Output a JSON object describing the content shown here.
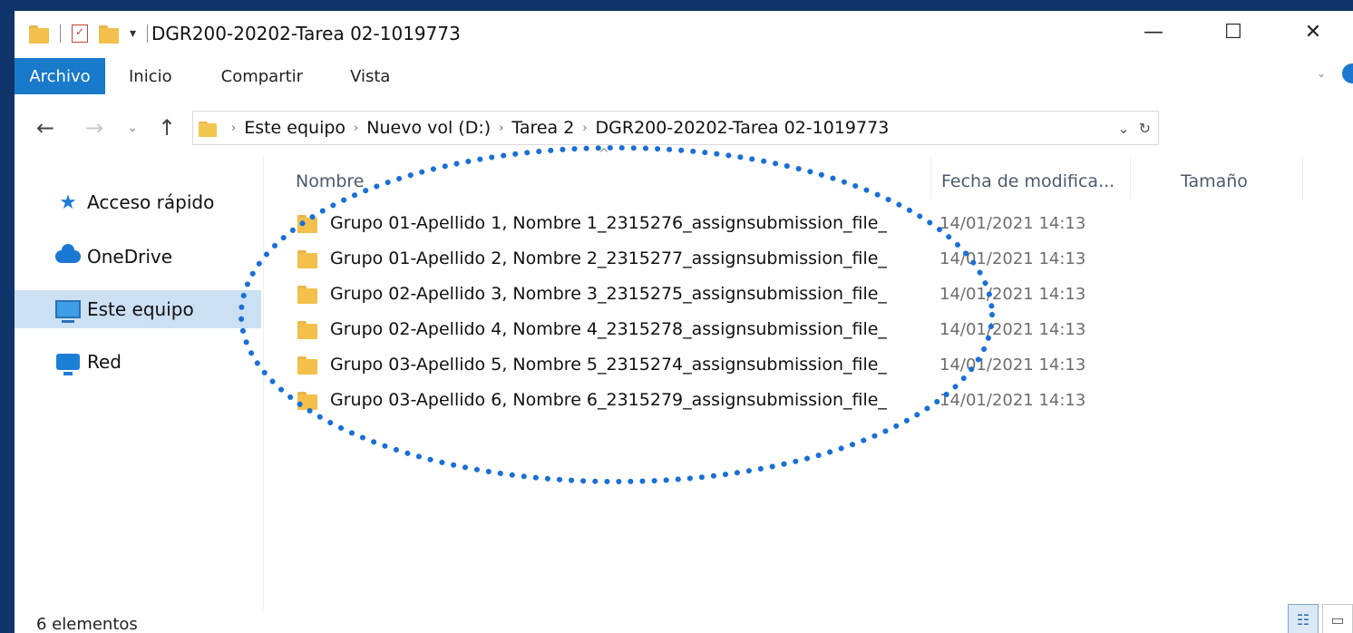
{
  "window": {
    "title": "DGR200-20202-Tarea 02-1019773",
    "quick_access_dropdown": "▾",
    "controls": {
      "minimize": "—",
      "maximize": "☐",
      "close": "✕"
    }
  },
  "ribbon": {
    "tabs": [
      "Archivo",
      "Inicio",
      "Compartir",
      "Vista"
    ],
    "expand_chevron": "⌄"
  },
  "nav": {
    "back": "←",
    "forward": "→",
    "recent": "⌄",
    "up": "↑",
    "breadcrumb": [
      "Este equipo",
      "Nuevo vol (D:)",
      "Tarea 2",
      "DGR200-20202-Tarea 02-1019773"
    ],
    "breadcrumb_separator": "›",
    "history_dropdown": "⌄",
    "refresh": "↻"
  },
  "sidebar": {
    "items": [
      {
        "label": "Acceso rápido",
        "icon": "star-icon"
      },
      {
        "label": "OneDrive",
        "icon": "cloud-icon"
      },
      {
        "label": "Este equipo",
        "icon": "computer-icon",
        "selected": true
      },
      {
        "label": "Red",
        "icon": "network-icon"
      }
    ]
  },
  "columns": {
    "name": "Nombre",
    "date": "Fecha de modifica...",
    "size": "Tamaño",
    "sort_indicator": "^"
  },
  "files": [
    {
      "name": "Grupo 01-Apellido 1, Nombre 1_2315276_assignsubmission_file_",
      "date": "14/01/2021 14:13",
      "type": "folder"
    },
    {
      "name": "Grupo 01-Apellido 2, Nombre 2_2315277_assignsubmission_file_",
      "date": "14/01/2021 14:13",
      "type": "folder"
    },
    {
      "name": "Grupo 02-Apellido 3, Nombre 3_2315275_assignsubmission_file_",
      "date": "14/01/2021 14:13",
      "type": "folder"
    },
    {
      "name": "Grupo 02-Apellido 4, Nombre 4_2315278_assignsubmission_file_",
      "date": "14/01/2021 14:13",
      "type": "folder"
    },
    {
      "name": "Grupo 03-Apellido 5, Nombre 5_2315274_assignsubmission_file_",
      "date": "14/01/2021 14:13",
      "type": "folder"
    },
    {
      "name": "Grupo 03-Apellido 6, Nombre 6_2315279_assignsubmission_file_",
      "date": "14/01/2021 14:13",
      "type": "folder"
    }
  ],
  "status": {
    "count": "6 elementos"
  },
  "view_buttons": {
    "details": "☷",
    "large_icons": "▭"
  },
  "colors": {
    "background": "#0e3469",
    "file_tab": "#1979ca",
    "selected_item": "#cce0f4",
    "folder": "#f2c04b",
    "highlight_ellipse": "#1a6fd6"
  }
}
